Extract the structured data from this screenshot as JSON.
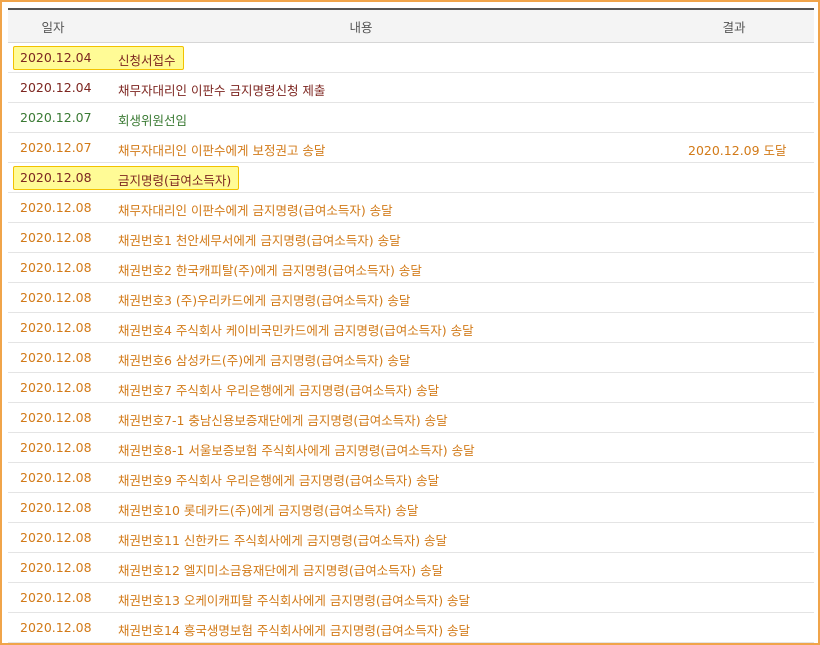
{
  "header": {
    "date_label": "일자",
    "content_label": "내용",
    "result_label": "결과"
  },
  "colors": {
    "dark": "#7d2620",
    "green": "#3a7a33",
    "orange": "#d27a18",
    "highlight": "#fffb96",
    "highlight_border": "#f2c200",
    "frame_border": "#f0a44a"
  },
  "rows": [
    {
      "date": "2020.12.04",
      "content": "신청서접수",
      "result": "",
      "color": "dark",
      "highlight": true
    },
    {
      "date": "2020.12.04",
      "content": "채무자대리인 이판수 금지명령신청 제출",
      "result": "",
      "color": "dark",
      "highlight": false
    },
    {
      "date": "2020.12.07",
      "content": "회생위원선임",
      "result": "",
      "color": "green",
      "highlight": false
    },
    {
      "date": "2020.12.07",
      "content": "채무자대리인 이판수에게 보정권고 송달",
      "result": "2020.12.09 도달",
      "color": "orange",
      "highlight": false
    },
    {
      "date": "2020.12.08",
      "content": "금지명령(급여소득자)",
      "result": "",
      "color": "dark",
      "highlight": true
    },
    {
      "date": "2020.12.08",
      "content": "채무자대리인 이판수에게 금지명령(급여소득자) 송달",
      "result": "",
      "color": "orange",
      "highlight": false
    },
    {
      "date": "2020.12.08",
      "content": "채권번호1 천안세무서에게 금지명령(급여소득자) 송달",
      "result": "",
      "color": "orange",
      "highlight": false
    },
    {
      "date": "2020.12.08",
      "content": "채권번호2 한국캐피탈(주)에게 금지명령(급여소득자) 송달",
      "result": "",
      "color": "orange",
      "highlight": false
    },
    {
      "date": "2020.12.08",
      "content": "채권번호3 (주)우리카드에게 금지명령(급여소득자) 송달",
      "result": "",
      "color": "orange",
      "highlight": false
    },
    {
      "date": "2020.12.08",
      "content": "채권번호4 주식회사 케이비국민카드에게 금지명령(급여소득자) 송달",
      "result": "",
      "color": "orange",
      "highlight": false
    },
    {
      "date": "2020.12.08",
      "content": "채권번호6 삼성카드(주)에게 금지명령(급여소득자) 송달",
      "result": "",
      "color": "orange",
      "highlight": false
    },
    {
      "date": "2020.12.08",
      "content": "채권번호7 주식회사 우리은행에게 금지명령(급여소득자) 송달",
      "result": "",
      "color": "orange",
      "highlight": false
    },
    {
      "date": "2020.12.08",
      "content": "채권번호7-1 충남신용보증재단에게 금지명령(급여소득자) 송달",
      "result": "",
      "color": "orange",
      "highlight": false
    },
    {
      "date": "2020.12.08",
      "content": "채권번호8-1 서울보증보험 주식회사에게 금지명령(급여소득자) 송달",
      "result": "",
      "color": "orange",
      "highlight": false
    },
    {
      "date": "2020.12.08",
      "content": "채권번호9 주식회사 우리은행에게 금지명령(급여소득자) 송달",
      "result": "",
      "color": "orange",
      "highlight": false
    },
    {
      "date": "2020.12.08",
      "content": "채권번호10 롯데카드(주)에게 금지명령(급여소득자) 송달",
      "result": "",
      "color": "orange",
      "highlight": false
    },
    {
      "date": "2020.12.08",
      "content": "채권번호11 신한카드 주식회사에게 금지명령(급여소득자) 송달",
      "result": "",
      "color": "orange",
      "highlight": false
    },
    {
      "date": "2020.12.08",
      "content": "채권번호12 엘지미소금융재단에게 금지명령(급여소득자) 송달",
      "result": "",
      "color": "orange",
      "highlight": false
    },
    {
      "date": "2020.12.08",
      "content": "채권번호13 오케이캐피탈 주식회사에게 금지명령(급여소득자) 송달",
      "result": "",
      "color": "orange",
      "highlight": false
    },
    {
      "date": "2020.12.08",
      "content": "채권번호14 흥국생명보험 주식회사에게 금지명령(급여소득자) 송달",
      "result": "",
      "color": "orange",
      "highlight": false
    }
  ]
}
